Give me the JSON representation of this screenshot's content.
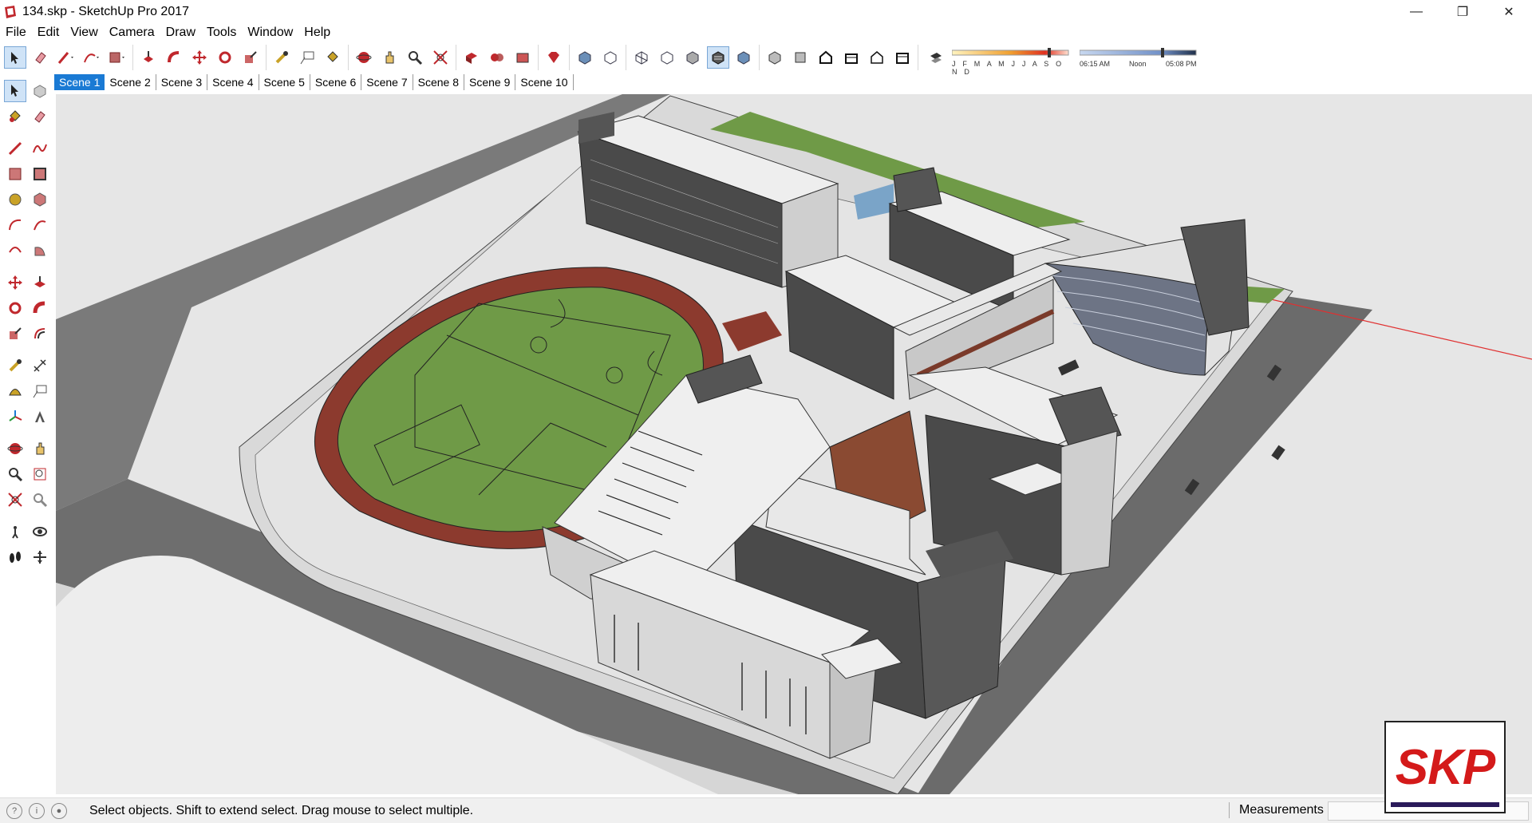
{
  "window": {
    "title": "134.skp - SketchUp Pro 2017",
    "minimize": "—",
    "restore": "❐",
    "close": "✕"
  },
  "menu": [
    "File",
    "Edit",
    "View",
    "Camera",
    "Draw",
    "Tools",
    "Window",
    "Help"
  ],
  "shadow_settings": {
    "months": "J F M A M J J A S O N D",
    "time_start": "06:15 AM",
    "time_mid": "Noon",
    "time_end": "05:08 PM"
  },
  "scenes": [
    "Scene 1",
    "Scene 2",
    "Scene 3",
    "Scene 4",
    "Scene 5",
    "Scene 6",
    "Scene 7",
    "Scene 8",
    "Scene 9",
    "Scene 10"
  ],
  "active_scene": "Scene 1",
  "status": {
    "message": "Select objects. Shift to extend select. Drag mouse to select multiple.",
    "measurements_label": "Measurements",
    "measurements_value": ""
  },
  "watermark": "SKP",
  "colors": {
    "accent": "#1a7ad4",
    "tool_red": "#c0282d",
    "turf": "#6f9a47",
    "track": "#8c3a2e",
    "road": "#6e6e6e",
    "building": "#e8e8e8",
    "building_dark": "#4a4a4a"
  }
}
